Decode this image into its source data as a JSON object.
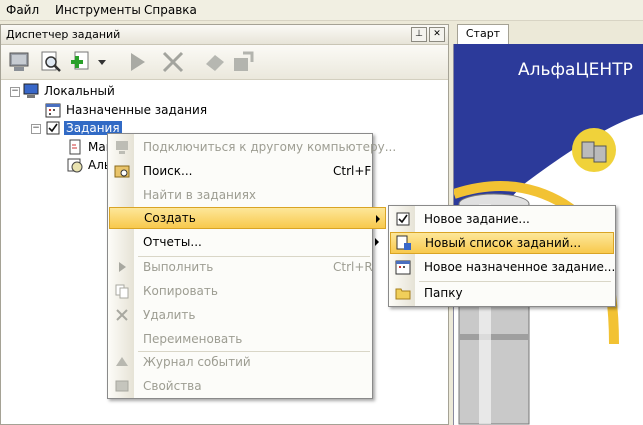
{
  "menubar": {
    "items": [
      "Файл",
      "Инструменты",
      "Справка"
    ]
  },
  "left_panel": {
    "title": "Диспетчер заданий",
    "pin_icon": "pin-icon",
    "close_icon": "close-icon"
  },
  "tree": {
    "root": "Локальный",
    "scheduled": "Назначенные задания",
    "tasks": "Задания",
    "child1": "Мак",
    "child2": "Аль"
  },
  "context_menu": {
    "items": [
      {
        "label": "Подключиться к другому компьютеру...",
        "shortcut": "",
        "enabled": false
      },
      {
        "label": "Поиск...",
        "shortcut": "Ctrl+F",
        "enabled": true
      },
      {
        "label": "Найти в заданиях",
        "shortcut": "",
        "enabled": false
      },
      {
        "label": "Создать",
        "shortcut": "",
        "enabled": true,
        "submenu": true
      },
      {
        "label": "Отчеты...",
        "shortcut": "",
        "enabled": true,
        "submenu": true
      },
      {
        "label": "Выполнить",
        "shortcut": "Ctrl+R",
        "enabled": false
      },
      {
        "label": "Копировать",
        "shortcut": "",
        "enabled": false
      },
      {
        "label": "Удалить",
        "shortcut": "",
        "enabled": false
      },
      {
        "label": "Переименовать",
        "shortcut": "",
        "enabled": false
      },
      {
        "label": "Журнал событий",
        "shortcut": "",
        "enabled": false
      },
      {
        "label": "Свойства",
        "shortcut": "",
        "enabled": false
      }
    ]
  },
  "submenu": {
    "items": [
      {
        "label": "Новое задание..."
      },
      {
        "label": "Новый список заданий..."
      },
      {
        "label": "Новое назначенное задание..."
      },
      {
        "label": "Папку"
      }
    ]
  },
  "right_panel": {
    "tab": "Старт",
    "heading": "АльфаЦЕНТР"
  },
  "colors": {
    "selection": "#316ac5",
    "highlight": "#f8c94d",
    "start_bg": "#2c3a9a"
  }
}
